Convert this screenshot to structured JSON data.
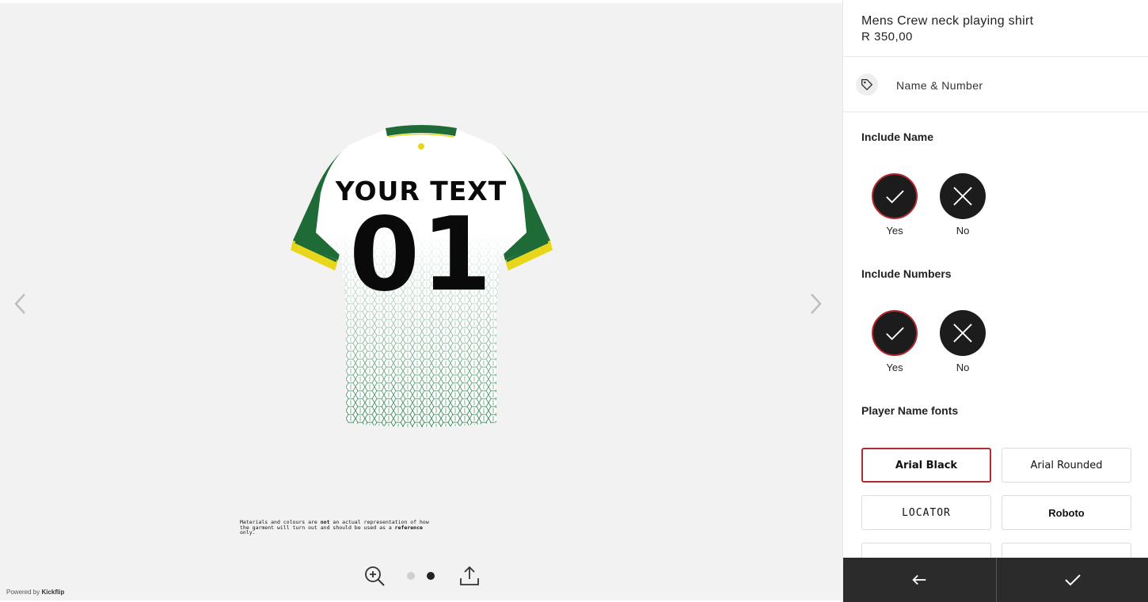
{
  "viewer": {
    "shirt": {
      "name_text": "YOUR TEXT",
      "number_text": "01",
      "colors": {
        "body": "#ffffff",
        "pattern": "#1f7a43",
        "sleeves": "#1e6b37",
        "trim": "#e8d61a",
        "print": "#0a0a0a"
      }
    },
    "disclaimer": {
      "part1": "Materials and colours are ",
      "bold1": "not",
      "part2": " an actual representation of how the garment will turn out and should be used as a ",
      "bold2": "reference",
      "part3": " only."
    },
    "pagination": {
      "current": 2,
      "total": 2
    },
    "powered_prefix": "Powered by ",
    "powered_brand": "Kickflip"
  },
  "product": {
    "title": "Mens Crew neck playing shirt",
    "price": "R 350,00"
  },
  "section": {
    "label": "Name & Number",
    "icon": "tag-icon"
  },
  "include_name": {
    "title": "Include Name",
    "options": [
      {
        "label": "Yes",
        "icon": "check-icon",
        "selected": true
      },
      {
        "label": "No",
        "icon": "close-icon",
        "selected": false
      }
    ]
  },
  "include_numbers": {
    "title": "Include Numbers",
    "options": [
      {
        "label": "Yes",
        "icon": "check-icon",
        "selected": true
      },
      {
        "label": "No",
        "icon": "close-icon",
        "selected": false
      }
    ]
  },
  "fonts": {
    "title": "Player Name fonts",
    "options": [
      {
        "label": "Arial Black",
        "selected": true
      },
      {
        "label": "Arial Rounded",
        "selected": false
      },
      {
        "label": "LOCATOR",
        "selected": false
      },
      {
        "label": "Roboto",
        "selected": false
      }
    ]
  },
  "footer": {
    "back_icon": "arrow-left-icon",
    "confirm_icon": "check-icon"
  },
  "accent_color": "#b22a30"
}
